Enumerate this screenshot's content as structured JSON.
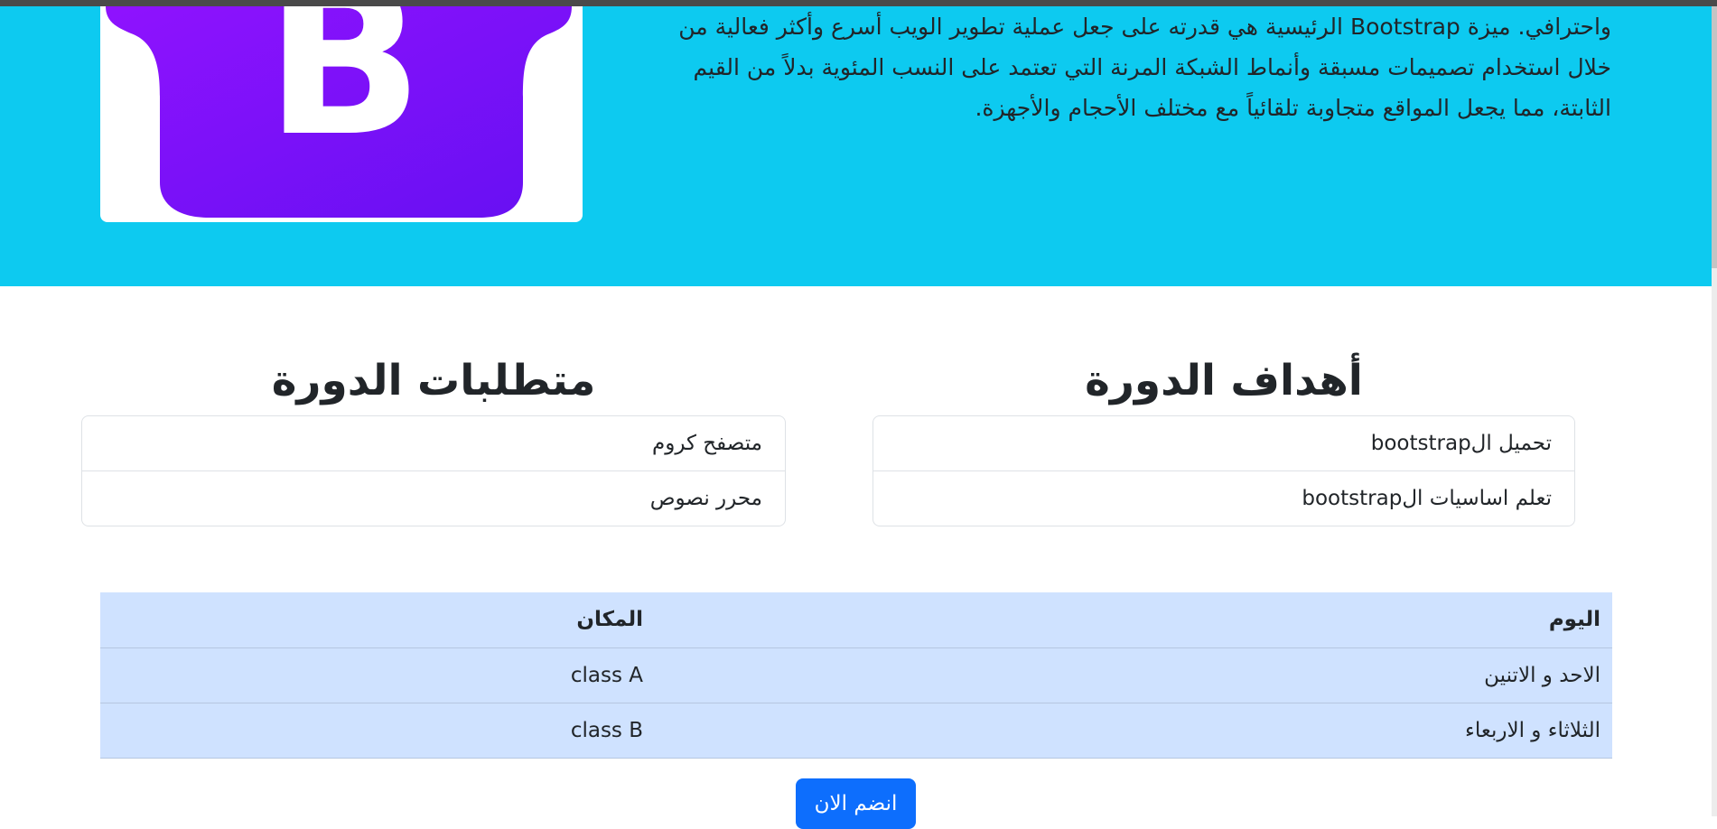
{
  "hero": {
    "paragraph_lines": [
      "واحترافي. ميزة Bootstrap الرئيسية هي قدرته على جعل عملية تطوير الويب أسرع وأكثر فعالية من",
      "خلال استخدام تصميمات مسبقة وأنماط الشبكة المرنة التي تعتمد على النسب المئوية بدلاً من القيم",
      "الثابتة، مما يجعل المواقع متجاوبة تلقائياً مع مختلف الأحجام والأجهزة."
    ],
    "logo_letter": "B",
    "background_color": "#0dcaf0",
    "logo_color": "#7a12f8"
  },
  "goals": {
    "title": "أهداف الدورة",
    "items": [
      "تحميل الbootstrap",
      "تعلم اساسيات الbootstrap"
    ]
  },
  "requirements": {
    "title": "متطلبات الدورة",
    "items": [
      "متصفح كروم",
      "محرر نصوص"
    ]
  },
  "schedule": {
    "headers": {
      "day": "اليوم",
      "place": "المكان"
    },
    "rows": [
      {
        "day": "الاحد و الاتنين",
        "place": "class A"
      },
      {
        "day": "الثلاثاء و الاربعاء",
        "place": "class B"
      }
    ],
    "background_color": "#cfe2ff"
  },
  "join_button": {
    "label": "انضم الان",
    "color": "#0d6efd"
  }
}
